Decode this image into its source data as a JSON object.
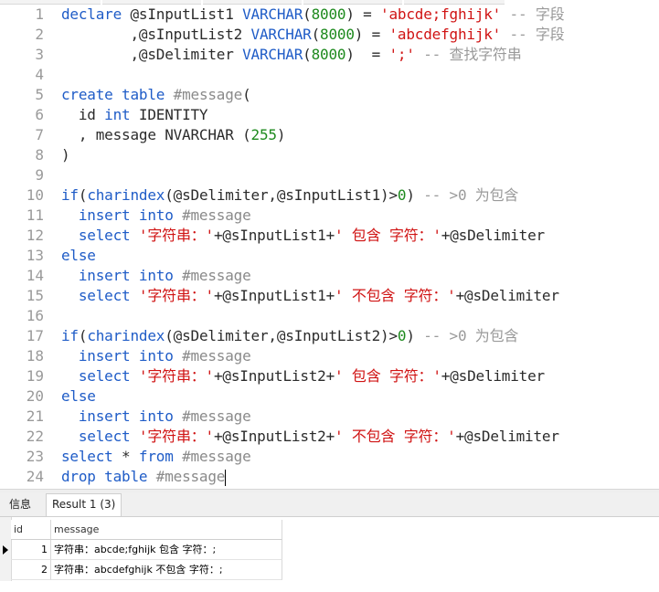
{
  "editor": {
    "lines": [
      {
        "n": "1",
        "tokens": [
          [
            "kw",
            "declare "
          ],
          [
            "var",
            "@sInputList1 "
          ],
          [
            "kw",
            "VARCHAR"
          ],
          [
            "pl",
            "("
          ],
          [
            "num",
            "8000"
          ],
          [
            "pl",
            ") = "
          ],
          [
            "str",
            "'abcde;fghijk'"
          ],
          [
            "cm",
            " -- 字段"
          ]
        ]
      },
      {
        "n": "2",
        "tokens": [
          [
            "pl",
            "        ,"
          ],
          [
            "var",
            "@sInputList2 "
          ],
          [
            "kw",
            "VARCHAR"
          ],
          [
            "pl",
            "("
          ],
          [
            "num",
            "8000"
          ],
          [
            "pl",
            ") = "
          ],
          [
            "str",
            "'abcdefghijk'"
          ],
          [
            "cm",
            " -- 字段"
          ]
        ]
      },
      {
        "n": "3",
        "tokens": [
          [
            "pl",
            "        ,"
          ],
          [
            "var",
            "@sDelimiter "
          ],
          [
            "kw",
            "VARCHAR"
          ],
          [
            "pl",
            "("
          ],
          [
            "num",
            "8000"
          ],
          [
            "pl",
            ")  = "
          ],
          [
            "str",
            "';'"
          ],
          [
            "cm",
            " -- 查找字符串"
          ]
        ]
      },
      {
        "n": "4",
        "tokens": []
      },
      {
        "n": "5",
        "tokens": [
          [
            "kw",
            "create table "
          ],
          [
            "tbl",
            "#message"
          ],
          [
            "pl",
            "("
          ]
        ]
      },
      {
        "n": "6",
        "tokens": [
          [
            "pl",
            "  id "
          ],
          [
            "kw",
            "int "
          ],
          [
            "pl",
            "IDENTITY"
          ]
        ]
      },
      {
        "n": "7",
        "tokens": [
          [
            "pl",
            "  , message NVARCHAR ("
          ],
          [
            "num",
            "255"
          ],
          [
            "pl",
            ")"
          ]
        ]
      },
      {
        "n": "8",
        "tokens": [
          [
            "pl",
            ")"
          ]
        ]
      },
      {
        "n": "9",
        "tokens": []
      },
      {
        "n": "10",
        "tokens": [
          [
            "kw",
            "if"
          ],
          [
            "pl",
            "("
          ],
          [
            "fn",
            "charindex"
          ],
          [
            "pl",
            "(@sDelimiter,@sInputList1)>"
          ],
          [
            "num",
            "0"
          ],
          [
            "pl",
            ")"
          ],
          [
            "cm",
            " -- >0 为包含"
          ]
        ]
      },
      {
        "n": "11",
        "tokens": [
          [
            "kw",
            "  insert into "
          ],
          [
            "tbl",
            "#message"
          ]
        ]
      },
      {
        "n": "12",
        "tokens": [
          [
            "kw",
            "  select "
          ],
          [
            "str",
            "'字符串：'"
          ],
          [
            "pl",
            "+@sInputList1+"
          ],
          [
            "str",
            "' 包含 字符：'"
          ],
          [
            "pl",
            "+@sDelimiter"
          ]
        ]
      },
      {
        "n": "13",
        "tokens": [
          [
            "kw",
            "else"
          ]
        ]
      },
      {
        "n": "14",
        "tokens": [
          [
            "kw",
            "  insert into "
          ],
          [
            "tbl",
            "#message"
          ]
        ]
      },
      {
        "n": "15",
        "tokens": [
          [
            "kw",
            "  select "
          ],
          [
            "str",
            "'字符串：'"
          ],
          [
            "pl",
            "+@sInputList1+"
          ],
          [
            "str",
            "' 不包含 字符：'"
          ],
          [
            "pl",
            "+@sDelimiter"
          ]
        ]
      },
      {
        "n": "16",
        "tokens": []
      },
      {
        "n": "17",
        "tokens": [
          [
            "kw",
            "if"
          ],
          [
            "pl",
            "("
          ],
          [
            "fn",
            "charindex"
          ],
          [
            "pl",
            "(@sDelimiter,@sInputList2)>"
          ],
          [
            "num",
            "0"
          ],
          [
            "pl",
            ")"
          ],
          [
            "cm",
            " -- >0 为包含"
          ]
        ]
      },
      {
        "n": "18",
        "tokens": [
          [
            "kw",
            "  insert into "
          ],
          [
            "tbl",
            "#message"
          ]
        ]
      },
      {
        "n": "19",
        "tokens": [
          [
            "kw",
            "  select "
          ],
          [
            "str",
            "'字符串：'"
          ],
          [
            "pl",
            "+@sInputList2+"
          ],
          [
            "str",
            "' 包含 字符：'"
          ],
          [
            "pl",
            "+@sDelimiter"
          ]
        ]
      },
      {
        "n": "20",
        "tokens": [
          [
            "kw",
            "else"
          ]
        ]
      },
      {
        "n": "21",
        "tokens": [
          [
            "kw",
            "  insert into "
          ],
          [
            "tbl",
            "#message"
          ]
        ]
      },
      {
        "n": "22",
        "tokens": [
          [
            "kw",
            "  select "
          ],
          [
            "str",
            "'字符串：'"
          ],
          [
            "pl",
            "+@sInputList2+"
          ],
          [
            "str",
            "' 不包含 字符：'"
          ],
          [
            "pl",
            "+@sDelimiter"
          ]
        ]
      },
      {
        "n": "23",
        "tokens": [
          [
            "kw",
            "select "
          ],
          [
            "pl",
            "* "
          ],
          [
            "kw",
            "from "
          ],
          [
            "tbl",
            "#message"
          ]
        ]
      },
      {
        "n": "24",
        "tokens": [
          [
            "kw",
            "drop table "
          ],
          [
            "tbl",
            "#message"
          ]
        ]
      }
    ]
  },
  "results": {
    "tabs": [
      "信息",
      "Result 1 (3)"
    ],
    "columns": [
      "id",
      "message"
    ],
    "rows": [
      {
        "id": "1",
        "message": "字符串：abcde;fghijk 包含 字符：;"
      },
      {
        "id": "2",
        "message": "字符串：abcdefghijk 不包含 字符：;"
      }
    ]
  },
  "colors": {
    "keyword": "#1f5cc7",
    "string": "#d01414",
    "number": "#1e8a1e",
    "comment": "#9a9a9a"
  }
}
